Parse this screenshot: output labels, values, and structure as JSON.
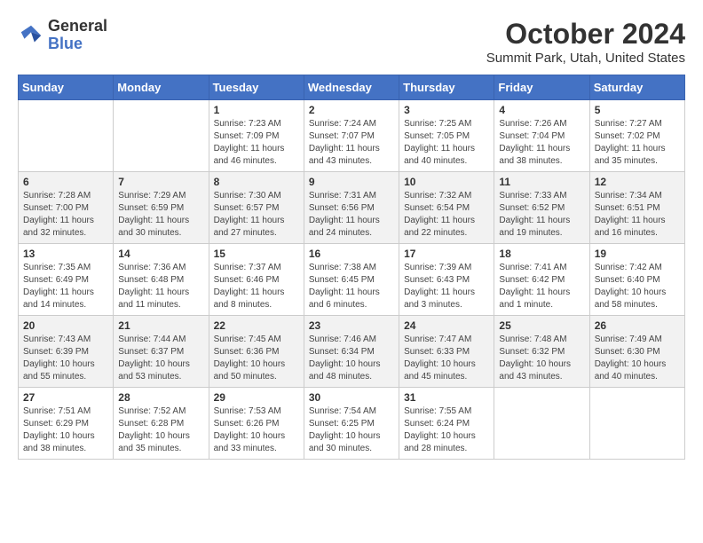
{
  "header": {
    "logo_line1": "General",
    "logo_line2": "Blue",
    "title": "October 2024",
    "subtitle": "Summit Park, Utah, United States"
  },
  "weekdays": [
    "Sunday",
    "Monday",
    "Tuesday",
    "Wednesday",
    "Thursday",
    "Friday",
    "Saturday"
  ],
  "weeks": [
    [
      {
        "day": "",
        "info": ""
      },
      {
        "day": "",
        "info": ""
      },
      {
        "day": "1",
        "info": "Sunrise: 7:23 AM\nSunset: 7:09 PM\nDaylight: 11 hours and 46 minutes."
      },
      {
        "day": "2",
        "info": "Sunrise: 7:24 AM\nSunset: 7:07 PM\nDaylight: 11 hours and 43 minutes."
      },
      {
        "day": "3",
        "info": "Sunrise: 7:25 AM\nSunset: 7:05 PM\nDaylight: 11 hours and 40 minutes."
      },
      {
        "day": "4",
        "info": "Sunrise: 7:26 AM\nSunset: 7:04 PM\nDaylight: 11 hours and 38 minutes."
      },
      {
        "day": "5",
        "info": "Sunrise: 7:27 AM\nSunset: 7:02 PM\nDaylight: 11 hours and 35 minutes."
      }
    ],
    [
      {
        "day": "6",
        "info": "Sunrise: 7:28 AM\nSunset: 7:00 PM\nDaylight: 11 hours and 32 minutes."
      },
      {
        "day": "7",
        "info": "Sunrise: 7:29 AM\nSunset: 6:59 PM\nDaylight: 11 hours and 30 minutes."
      },
      {
        "day": "8",
        "info": "Sunrise: 7:30 AM\nSunset: 6:57 PM\nDaylight: 11 hours and 27 minutes."
      },
      {
        "day": "9",
        "info": "Sunrise: 7:31 AM\nSunset: 6:56 PM\nDaylight: 11 hours and 24 minutes."
      },
      {
        "day": "10",
        "info": "Sunrise: 7:32 AM\nSunset: 6:54 PM\nDaylight: 11 hours and 22 minutes."
      },
      {
        "day": "11",
        "info": "Sunrise: 7:33 AM\nSunset: 6:52 PM\nDaylight: 11 hours and 19 minutes."
      },
      {
        "day": "12",
        "info": "Sunrise: 7:34 AM\nSunset: 6:51 PM\nDaylight: 11 hours and 16 minutes."
      }
    ],
    [
      {
        "day": "13",
        "info": "Sunrise: 7:35 AM\nSunset: 6:49 PM\nDaylight: 11 hours and 14 minutes."
      },
      {
        "day": "14",
        "info": "Sunrise: 7:36 AM\nSunset: 6:48 PM\nDaylight: 11 hours and 11 minutes."
      },
      {
        "day": "15",
        "info": "Sunrise: 7:37 AM\nSunset: 6:46 PM\nDaylight: 11 hours and 8 minutes."
      },
      {
        "day": "16",
        "info": "Sunrise: 7:38 AM\nSunset: 6:45 PM\nDaylight: 11 hours and 6 minutes."
      },
      {
        "day": "17",
        "info": "Sunrise: 7:39 AM\nSunset: 6:43 PM\nDaylight: 11 hours and 3 minutes."
      },
      {
        "day": "18",
        "info": "Sunrise: 7:41 AM\nSunset: 6:42 PM\nDaylight: 11 hours and 1 minute."
      },
      {
        "day": "19",
        "info": "Sunrise: 7:42 AM\nSunset: 6:40 PM\nDaylight: 10 hours and 58 minutes."
      }
    ],
    [
      {
        "day": "20",
        "info": "Sunrise: 7:43 AM\nSunset: 6:39 PM\nDaylight: 10 hours and 55 minutes."
      },
      {
        "day": "21",
        "info": "Sunrise: 7:44 AM\nSunset: 6:37 PM\nDaylight: 10 hours and 53 minutes."
      },
      {
        "day": "22",
        "info": "Sunrise: 7:45 AM\nSunset: 6:36 PM\nDaylight: 10 hours and 50 minutes."
      },
      {
        "day": "23",
        "info": "Sunrise: 7:46 AM\nSunset: 6:34 PM\nDaylight: 10 hours and 48 minutes."
      },
      {
        "day": "24",
        "info": "Sunrise: 7:47 AM\nSunset: 6:33 PM\nDaylight: 10 hours and 45 minutes."
      },
      {
        "day": "25",
        "info": "Sunrise: 7:48 AM\nSunset: 6:32 PM\nDaylight: 10 hours and 43 minutes."
      },
      {
        "day": "26",
        "info": "Sunrise: 7:49 AM\nSunset: 6:30 PM\nDaylight: 10 hours and 40 minutes."
      }
    ],
    [
      {
        "day": "27",
        "info": "Sunrise: 7:51 AM\nSunset: 6:29 PM\nDaylight: 10 hours and 38 minutes."
      },
      {
        "day": "28",
        "info": "Sunrise: 7:52 AM\nSunset: 6:28 PM\nDaylight: 10 hours and 35 minutes."
      },
      {
        "day": "29",
        "info": "Sunrise: 7:53 AM\nSunset: 6:26 PM\nDaylight: 10 hours and 33 minutes."
      },
      {
        "day": "30",
        "info": "Sunrise: 7:54 AM\nSunset: 6:25 PM\nDaylight: 10 hours and 30 minutes."
      },
      {
        "day": "31",
        "info": "Sunrise: 7:55 AM\nSunset: 6:24 PM\nDaylight: 10 hours and 28 minutes."
      },
      {
        "day": "",
        "info": ""
      },
      {
        "day": "",
        "info": ""
      }
    ]
  ]
}
